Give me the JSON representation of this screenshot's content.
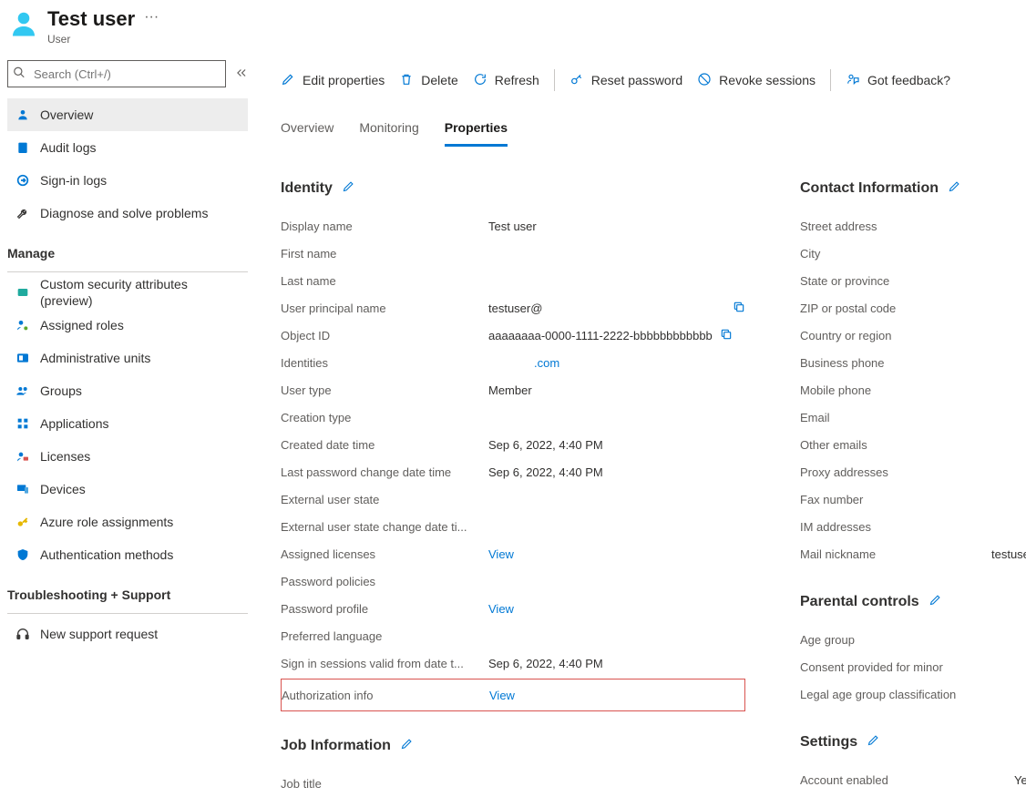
{
  "header": {
    "title": "Test user",
    "subtitle": "User"
  },
  "sidebar": {
    "search_placeholder": "Search (Ctrl+/)",
    "nav": {
      "overview": "Overview",
      "audit_logs": "Audit logs",
      "signin_logs": "Sign-in logs",
      "diagnose": "Diagnose and solve problems"
    },
    "manage_title": "Manage",
    "manage": {
      "custom_security": "Custom security attributes (preview)",
      "assigned_roles": "Assigned roles",
      "admin_units": "Administrative units",
      "groups": "Groups",
      "applications": "Applications",
      "licenses": "Licenses",
      "devices": "Devices",
      "azure_role": "Azure role assignments",
      "auth_methods": "Authentication methods"
    },
    "troubleshooting_title": "Troubleshooting + Support",
    "troubleshooting": {
      "support": "New support request"
    }
  },
  "toolbar": {
    "edit": "Edit properties",
    "delete": "Delete",
    "refresh": "Refresh",
    "reset_password": "Reset password",
    "revoke": "Revoke sessions",
    "feedback": "Got feedback?"
  },
  "tabs": {
    "overview": "Overview",
    "monitoring": "Monitoring",
    "properties": "Properties"
  },
  "identity": {
    "title": "Identity",
    "display_name_label": "Display name",
    "display_name_value": "Test user",
    "first_name_label": "First name",
    "last_name_label": "Last name",
    "upn_label": "User principal name",
    "upn_value": "testuser@",
    "object_id_label": "Object ID",
    "object_id_value": "aaaaaaaa-0000-1111-2222-bbbbbbbbbbbb",
    "identities_label": "Identities",
    "identities_value": ".com",
    "user_type_label": "User type",
    "user_type_value": "Member",
    "creation_type_label": "Creation type",
    "created_label": "Created date time",
    "created_value": "Sep 6, 2022, 4:40 PM",
    "last_pw_label": "Last password change date time",
    "last_pw_value": "Sep 6, 2022, 4:40 PM",
    "ext_state_label": "External user state",
    "ext_state_change_label": "External user state change date ti...",
    "licenses_label": "Assigned licenses",
    "licenses_value": "View",
    "pw_policies_label": "Password policies",
    "pw_profile_label": "Password profile",
    "pw_profile_value": "View",
    "pref_lang_label": "Preferred language",
    "signin_valid_label": "Sign in sessions valid from date t...",
    "signin_valid_value": "Sep 6, 2022, 4:40 PM",
    "auth_info_label": "Authorization info",
    "auth_info_value": "View"
  },
  "job": {
    "title": "Job Information",
    "job_title_label": "Job title"
  },
  "contact": {
    "title": "Contact Information",
    "street_label": "Street address",
    "city_label": "City",
    "state_label": "State or province",
    "zip_label": "ZIP or postal code",
    "country_label": "Country or region",
    "bus_phone_label": "Business phone",
    "mob_phone_label": "Mobile phone",
    "email_label": "Email",
    "other_emails_label": "Other emails",
    "proxy_label": "Proxy addresses",
    "fax_label": "Fax number",
    "im_label": "IM addresses",
    "mail_nick_label": "Mail nickname",
    "mail_nick_value": "testuser"
  },
  "parental": {
    "title": "Parental controls",
    "age_label": "Age group",
    "consent_label": "Consent provided for minor",
    "legal_label": "Legal age group classification"
  },
  "settings": {
    "title": "Settings",
    "account_enabled_label": "Account enabled",
    "account_enabled_value": "Yes"
  }
}
